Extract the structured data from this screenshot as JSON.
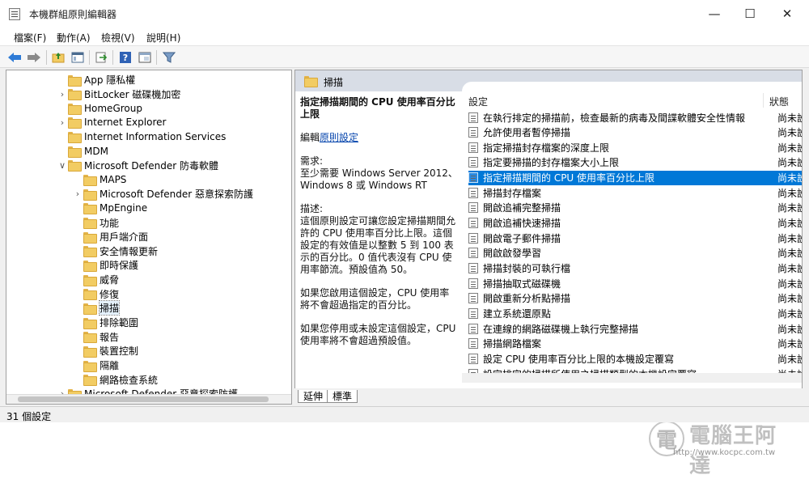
{
  "window": {
    "title": "本機群組原則編輯器"
  },
  "menu": [
    "檔案(F)",
    "動作(A)",
    "檢視(V)",
    "說明(H)"
  ],
  "toolbar_icons": [
    "back-arrow-icon",
    "forward-arrow-icon",
    "up-folder-icon",
    "show-hide-tree-icon",
    "export-list-icon",
    "help-icon",
    "view-icon",
    "filter-icon"
  ],
  "tree": [
    {
      "label": "App 隱私權",
      "level": 1,
      "expandable": false
    },
    {
      "label": "BitLocker 磁碟機加密",
      "level": 1,
      "expandable": true
    },
    {
      "label": "HomeGroup",
      "level": 1,
      "expandable": false
    },
    {
      "label": "Internet Explorer",
      "level": 1,
      "expandable": true
    },
    {
      "label": "Internet Information Services",
      "level": 1,
      "expandable": false
    },
    {
      "label": "MDM",
      "level": 1,
      "expandable": false
    },
    {
      "label": "Microsoft Defender 防毒軟體",
      "level": 1,
      "expandable": true,
      "expanded": true
    },
    {
      "label": "MAPS",
      "level": 2,
      "expandable": false
    },
    {
      "label": "Microsoft Defender 惡意探索防護",
      "level": 2,
      "expandable": true
    },
    {
      "label": "MpEngine",
      "level": 2,
      "expandable": false
    },
    {
      "label": "功能",
      "level": 2,
      "expandable": false
    },
    {
      "label": "用戶端介面",
      "level": 2,
      "expandable": false
    },
    {
      "label": "安全情報更新",
      "level": 2,
      "expandable": false
    },
    {
      "label": "即時保護",
      "level": 2,
      "expandable": false
    },
    {
      "label": "威脅",
      "level": 2,
      "expandable": false
    },
    {
      "label": "修復",
      "level": 2,
      "expandable": false
    },
    {
      "label": "掃描",
      "level": 2,
      "expandable": false,
      "selected": true
    },
    {
      "label": "排除範圍",
      "level": 2,
      "expandable": false
    },
    {
      "label": "報告",
      "level": 2,
      "expandable": false
    },
    {
      "label": "裝置控制",
      "level": 2,
      "expandable": false
    },
    {
      "label": "隔離",
      "level": 2,
      "expandable": false
    },
    {
      "label": "網路檢查系統",
      "level": 2,
      "expandable": false
    },
    {
      "label": "Microsoft Defender 惡意探索防護",
      "level": 1,
      "expandable": true
    }
  ],
  "right_header": "掃描",
  "description": {
    "heading": "指定掃描期間的 CPU 使用率百分比上限",
    "edit_prefix": "編輯",
    "edit_link": "原則設定",
    "req_label": "需求:",
    "req_text": "至少需要 Windows Server 2012、Windows 8 或 Windows RT",
    "desc_label": "描述:",
    "desc_text": "這個原則設定可讓您設定掃描期間允許的 CPU 使用率百分比上限。這個設定的有效值是以整數 5 到 100 表示的百分比。0 值代表沒有 CPU 使用率節流。預設值為 50。",
    "enabled_text": "如果您啟用這個設定，CPU 使用率將不會超過指定的百分比。",
    "disabled_text": "如果您停用或未設定這個設定，CPU 使用率將不會超過預設值。"
  },
  "columns": {
    "setting": "設定",
    "state": "狀態"
  },
  "settings": [
    {
      "name": "在執行排定的掃描前，檢查最新的病毒及間諜軟體安全性情報",
      "state": "尚未設定"
    },
    {
      "name": "允許使用者暫停掃描",
      "state": "尚未設定"
    },
    {
      "name": "指定掃描封存檔案的深度上限",
      "state": "尚未設定"
    },
    {
      "name": "指定要掃描的封存檔案大小上限",
      "state": "尚未設定"
    },
    {
      "name": "指定掃描期間的 CPU 使用率百分比上限",
      "state": "尚未設定",
      "selected": true
    },
    {
      "name": "掃描封存檔案",
      "state": "尚未設定"
    },
    {
      "name": "開啟追補完整掃描",
      "state": "尚未設定"
    },
    {
      "name": "開啟追補快速掃描",
      "state": "尚未設定"
    },
    {
      "name": "開啟電子郵件掃描",
      "state": "尚未設定"
    },
    {
      "name": "開啟啟發學習",
      "state": "尚未設定"
    },
    {
      "name": "掃描封裝的可執行檔",
      "state": "尚未設定"
    },
    {
      "name": "掃描抽取式磁碟機",
      "state": "尚未設定"
    },
    {
      "name": "開啟重新分析點掃描",
      "state": "尚未設定"
    },
    {
      "name": "建立系統還原點",
      "state": "尚未設定"
    },
    {
      "name": "在連線的網路磁碟機上執行完整掃描",
      "state": "尚未設定"
    },
    {
      "name": "掃描網路檔案",
      "state": "尚未設定"
    },
    {
      "name": "設定 CPU 使用率百分比上限的本機設定覆寫",
      "state": "尚未設定"
    },
    {
      "name": "設定排定的掃描所使用之掃描類型的本機設定覆寫",
      "state": "尚未設定"
    }
  ],
  "tabs": [
    "延伸",
    "標準"
  ],
  "status": "31 個設定",
  "watermark": {
    "text": "電腦王阿達",
    "url": "http://www.kocpc.com.tw"
  },
  "colors": {
    "selection": "#0078d7",
    "header": "#d8dde6",
    "folder": "#f2cc63"
  }
}
